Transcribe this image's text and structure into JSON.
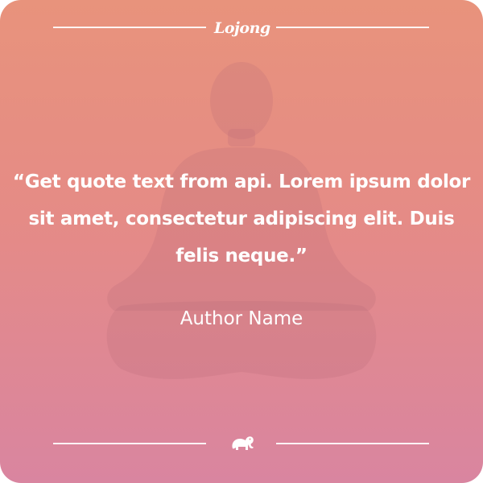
{
  "brand": {
    "logo_text": "Lojong"
  },
  "quote": {
    "text": "“Get quote text from api.  Lorem ipsum dolor\nsit amet, consectetur adipiscing elit. Duis\nfelis neque.”",
    "author": "Author Name"
  },
  "icons": {
    "silhouette": "meditation-figure-icon",
    "footer": "elephant-icon"
  },
  "colors": {
    "gradient_top": "#e8937c",
    "gradient_bottom": "#d985a0",
    "text": "#ffffff"
  }
}
